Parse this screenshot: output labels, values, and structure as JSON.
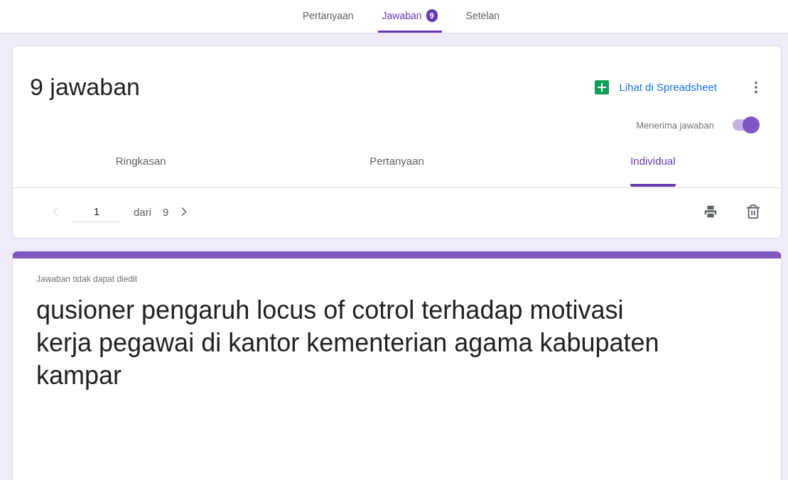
{
  "top_tabs": [
    {
      "label": "Pertanyaan",
      "selected": false
    },
    {
      "label": "Jawaban",
      "badge": "9",
      "selected": true
    },
    {
      "label": "Setelan",
      "selected": false
    }
  ],
  "summary_card": {
    "title": "9 jawaban",
    "sheet_link": "Lihat di Spreadsheet",
    "accepting": {
      "label": "Menerima jawaban",
      "on": true
    },
    "view_tabs": [
      {
        "label": "Ringkasan",
        "selected": false
      },
      {
        "label": "Pertanyaan",
        "selected": false
      },
      {
        "label": "Individual",
        "selected": true
      }
    ],
    "pager": {
      "prev_disabled": true,
      "current": "1",
      "of": "dari",
      "total": "9",
      "next_disabled": false
    }
  },
  "response_card": {
    "note": "Jawaban tidak dapat diedit",
    "form_title": "qusioner pengaruh locus of cotrol terhadap motivasi kerja pegawai di kantor kementerian agama kabupaten kampar"
  }
}
